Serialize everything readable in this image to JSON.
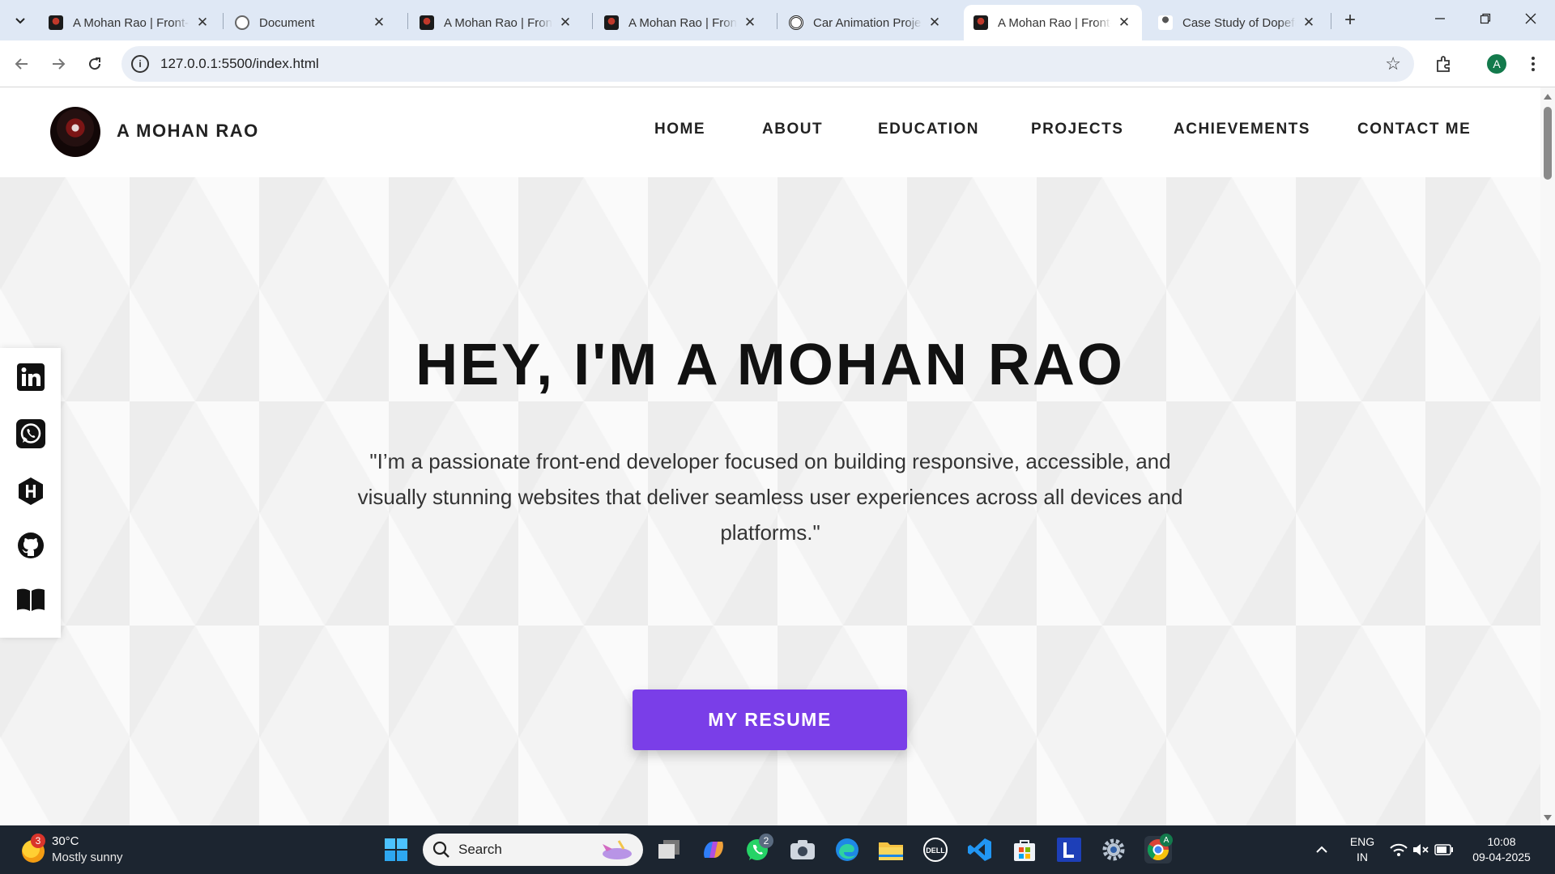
{
  "browser": {
    "tabs": [
      {
        "title": "A Mohan Rao | Front-end Developer",
        "favicon": "portrait-icon",
        "active": false
      },
      {
        "title": "Document",
        "favicon": "globe-icon",
        "active": false
      },
      {
        "title": "A Mohan Rao | Front-end Developer",
        "favicon": "portrait-icon",
        "active": false
      },
      {
        "title": "A Mohan Rao | Front-end Developer",
        "favicon": "portrait-icon",
        "active": false
      },
      {
        "title": "Car Animation Project",
        "favicon": "openai-icon",
        "active": false
      },
      {
        "title": "A Mohan Rao | Front-end Developer",
        "favicon": "portrait-icon",
        "active": true
      },
      {
        "title": "Case Study of Dopefolio",
        "favicon": "person-icon",
        "active": false
      }
    ],
    "close_glyph": "✕",
    "new_tab_glyph": "+",
    "url": "127.0.0.1:5500/index.html",
    "profile_initial": "A"
  },
  "site": {
    "brand": "A MOHAN RAO",
    "nav": [
      "HOME",
      "ABOUT",
      "EDUCATION",
      "PROJECTS",
      "ACHIEVEMENTS",
      "CONTACT ME"
    ],
    "hero_title": "HEY, I'M A MOHAN RAO",
    "hero_text": "\"I’m a passionate front-end developer focused on building responsive, accessible, and visually stunning websites that deliver seamless user experiences across all devices and platforms.\"",
    "resume_button": "MY RESUME",
    "socials": [
      "linkedin-icon",
      "whatsapp-icon",
      "hashnode-icon",
      "github-icon",
      "book-icon"
    ],
    "accent_color": "#7a3ee8"
  },
  "taskbar": {
    "weather_badge": "3",
    "temperature": "30°C",
    "weather": "Mostly sunny",
    "search_placeholder": "Search",
    "whatsapp_badge": "2",
    "chrome_badge": "A",
    "language_line1": "ENG",
    "language_line2": "IN",
    "time": "10:08",
    "date": "09-04-2025"
  }
}
